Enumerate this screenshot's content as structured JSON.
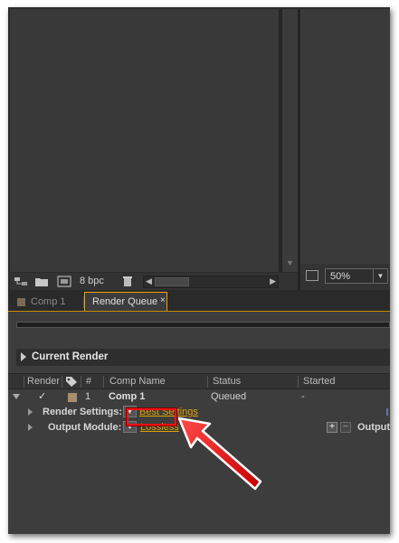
{
  "toolbar": {
    "bit_depth": "8 bpc",
    "icons": [
      "flowchart-icon",
      "folder-icon",
      "composition-icon",
      "trash-icon"
    ]
  },
  "viewer": {
    "zoom": "50%",
    "zoom_dropdown_icon": "chevron-down-icon"
  },
  "tabs": [
    {
      "label": "Comp 1",
      "active": false
    },
    {
      "label": "Render Queue",
      "active": true,
      "close": "×"
    }
  ],
  "render_queue": {
    "current_render_label": "Current Render",
    "columns": [
      "Render",
      "#",
      "Comp Name",
      "Status",
      "Started"
    ],
    "item": {
      "checked": "✓",
      "number": "1",
      "comp_name": "Comp 1",
      "status": "Queued",
      "started": "-",
      "render_settings_label": "Render Settings:",
      "render_settings_value": "Best Settings",
      "output_module_label": "Output Module:",
      "output_module_value": "Lossless",
      "output_to_label": "Output"
    }
  },
  "colors": {
    "accent": "#f0a000",
    "highlight": "#ff1111",
    "link": "#e0a200"
  }
}
